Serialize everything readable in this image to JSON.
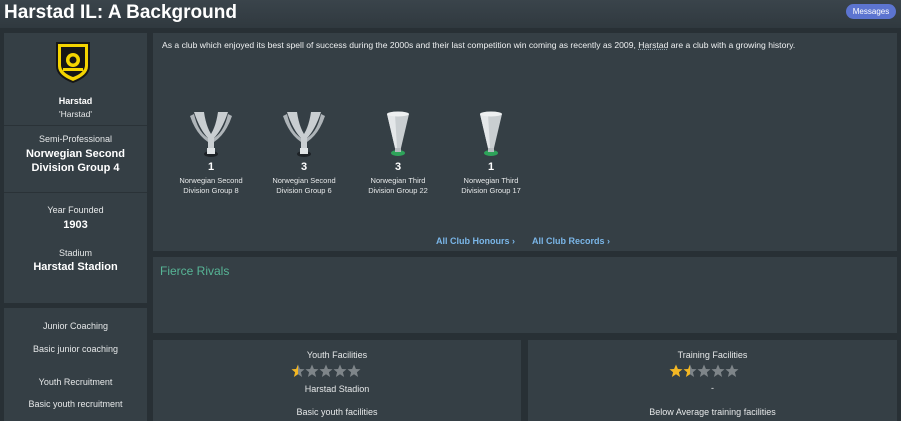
{
  "header": {
    "title": "Harstad IL: A Background",
    "messages_label": "Messages"
  },
  "club": {
    "name": "Harstad",
    "nickname": "'Harstad'",
    "status": "Semi-Professional",
    "league": "Norwegian Second Division Group 4",
    "year_founded_label": "Year Founded",
    "year_founded": "1903",
    "stadium_label": "Stadium",
    "stadium": "Harstad Stadion",
    "logo_icon": "club-crest-icon",
    "colors": {
      "crest_yellow": "#f4d400",
      "crest_black": "#161616"
    }
  },
  "facilities_left": {
    "junior_coaching_label": "Junior Coaching",
    "junior_coaching_value": "Basic junior coaching",
    "youth_recruitment_label": "Youth Recruitment",
    "youth_recruitment_value": "Basic youth recruitment"
  },
  "history": {
    "description_pre": "As a club which enjoyed its best spell of success during the 2000s and their last competition win coming as recently as 2009, ",
    "description_link": "Harstad",
    "description_post": " are a club with a growing history.",
    "trophies": [
      {
        "count": "1",
        "name_line1": "Norwegian Second",
        "name_line2": "Division Group 8",
        "icon": "silver-cup-icon"
      },
      {
        "count": "3",
        "name_line1": "Norwegian Second",
        "name_line2": "Division Group 6",
        "icon": "silver-cup-icon"
      },
      {
        "count": "3",
        "name_line1": "Norwegian Third",
        "name_line2": "Division Group 22",
        "icon": "silver-trophy-green-base-icon"
      },
      {
        "count": "1",
        "name_line1": "Norwegian Third",
        "name_line2": "Division Group 17",
        "icon": "silver-trophy-green-base-icon"
      }
    ],
    "all_honours_link": "All Club Honours",
    "all_records_link": "All Club Records",
    "chevron_icon": "chevron-right-icon"
  },
  "rivals": {
    "title": "Fierce Rivals"
  },
  "youth_facilities": {
    "title": "Youth Facilities",
    "rating": 0.5,
    "max_rating": 5,
    "stadium": "Harstad Stadion",
    "description": "Basic youth facilities"
  },
  "training_facilities": {
    "title": "Training Facilities",
    "rating": 1.5,
    "max_rating": 5,
    "subtext": "-",
    "description": "Below Average training facilities"
  },
  "colors": {
    "accent_link": "#7ab6e8",
    "rivals_green": "#57b596",
    "star_gold": "#f3b724",
    "star_grey": "#7e8589",
    "messages_blue": "#5c74d0"
  }
}
